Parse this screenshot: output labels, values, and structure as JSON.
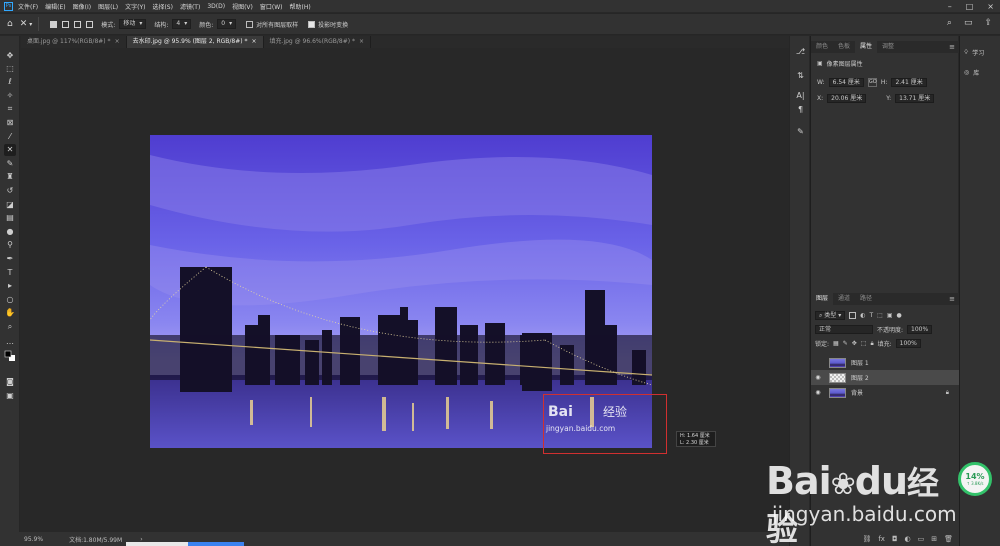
{
  "app": {
    "logo": "Ps",
    "menus": [
      "文件(F)",
      "编辑(E)",
      "图像(I)",
      "图层(L)",
      "文字(Y)",
      "选择(S)",
      "滤镜(T)",
      "3D(D)",
      "视图(V)",
      "窗口(W)",
      "帮助(H)"
    ]
  },
  "options": {
    "mode_label": "模式:",
    "mode_value": "移动",
    "structure_label": "结构:",
    "structure_value": "4",
    "color_label": "颜色:",
    "color_value": "0",
    "sample_all_label": "对所有图层取样",
    "transform_drop_label": "投影时变换"
  },
  "tabs": [
    {
      "label": "桌面.jpg @ 117%(RGB/8#) *",
      "close": "×"
    },
    {
      "label": "去水印.jpg @ 95.9% (图层 2, RGB/8#) *",
      "close": "×"
    },
    {
      "label": "填充.jpg @ 96.6%(RGB/8#) *",
      "close": "×"
    }
  ],
  "canvas": {
    "tooltip_w": "H: 1.64 厘米",
    "tooltip_h": "L: 2.30 厘米",
    "watermark_in_image_1": "Bai",
    "watermark_in_image_2": "经验",
    "watermark_in_image_url": "jingyan.baidu.com"
  },
  "status": {
    "zoom": "95.9%",
    "doc_info": "文档:1.80M/5.99M",
    "arrow": "›"
  },
  "properties": {
    "tabs": [
      "颜色",
      "色板",
      "属性",
      "调整"
    ],
    "active_tab": "属性",
    "section_title": "像素图层属性",
    "w_label": "W:",
    "w_value": "6.54 厘米",
    "h_label": "H:",
    "h_value": "2.41 厘米",
    "x_label": "X:",
    "x_value": "20.06 厘米",
    "y_label": "Y:",
    "y_value": "13.71 厘米",
    "link": "GO"
  },
  "layers": {
    "tabs": [
      "图层",
      "通道",
      "路径"
    ],
    "filter_value": "类型",
    "blend_mode": "正常",
    "opacity_label": "不透明度:",
    "opacity_value": "100%",
    "lock_label": "锁定:",
    "fill_label": "填充:",
    "fill_value": "100%",
    "items": [
      {
        "name": "图层 1",
        "visible": false,
        "selected": false
      },
      {
        "name": "图层 2",
        "visible": true,
        "selected": true
      },
      {
        "name": "背景",
        "visible": true,
        "selected": false,
        "locked": true
      }
    ]
  },
  "learn": {
    "learn_label": "学习",
    "library_label": "库"
  },
  "perf": {
    "percent": "14%",
    "speed": "↑ 3.8K/s"
  },
  "watermark": {
    "big_1": "Bai",
    "big_2": "du",
    "big_3": "经验",
    "url": "jingyan.baidu.com"
  }
}
